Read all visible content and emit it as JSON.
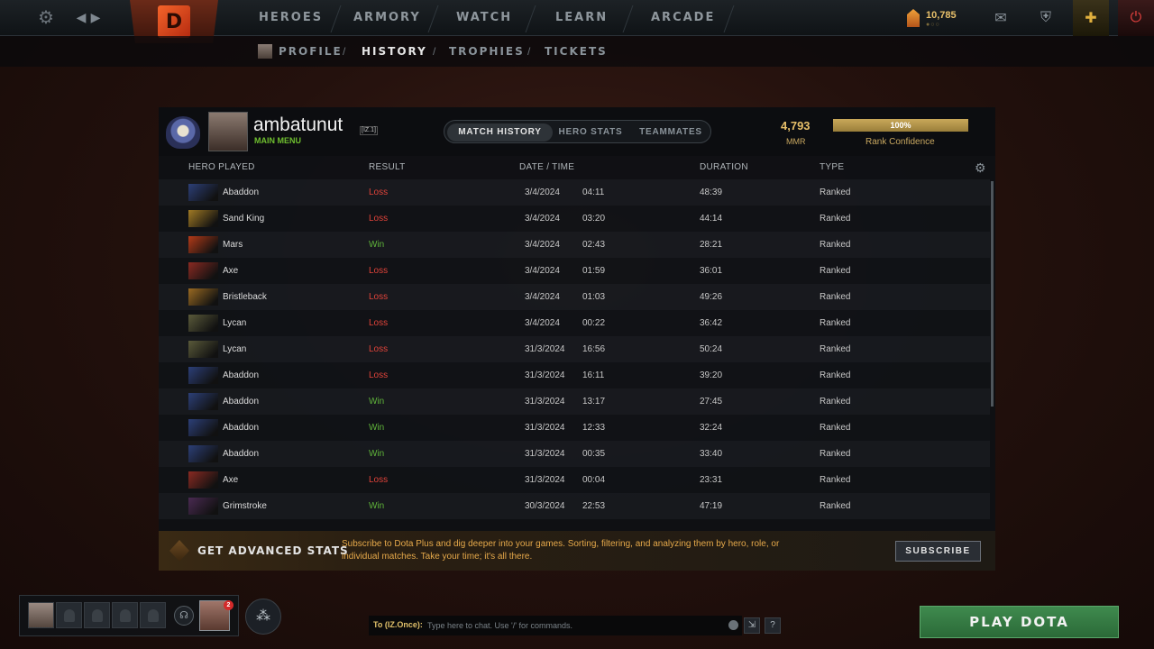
{
  "nav": {
    "items": [
      "HEROES",
      "ARMORY",
      "WATCH",
      "LEARN",
      "ARCADE"
    ],
    "logo_icon": "dota-logo-icon",
    "shards": "10,785"
  },
  "subnav": {
    "items": [
      "PROFILE",
      "HISTORY",
      "TROPHIES",
      "TICKETS"
    ],
    "active": "HISTORY"
  },
  "profile": {
    "name": "ambatunut",
    "tag": "[IZ.1]",
    "status": "MAIN MENU",
    "mmr": "4,793",
    "mmr_label": "MMR",
    "confidence_text": "100%",
    "confidence_fraction": 1.0,
    "confidence_label": "Rank Confidence"
  },
  "tabs": [
    "MATCH HISTORY",
    "HERO STATS",
    "TEAMMATES"
  ],
  "columns": {
    "hero": "HERO PLAYED",
    "result": "RESULT",
    "datetime": "DATE / TIME",
    "duration": "DURATION",
    "type": "TYPE"
  },
  "matches": [
    {
      "hero": "Abaddon",
      "result": "Loss",
      "date": "3/4/2024",
      "time": "04:11",
      "duration": "48:39",
      "type": "Ranked",
      "color": "#2c3f78"
    },
    {
      "hero": "Sand King",
      "result": "Loss",
      "date": "3/4/2024",
      "time": "03:20",
      "duration": "44:14",
      "type": "Ranked",
      "color": "#a07a24"
    },
    {
      "hero": "Mars",
      "result": "Win",
      "date": "3/4/2024",
      "time": "02:43",
      "duration": "28:21",
      "type": "Ranked",
      "color": "#b33a18"
    },
    {
      "hero": "Axe",
      "result": "Loss",
      "date": "3/4/2024",
      "time": "01:59",
      "duration": "36:01",
      "type": "Ranked",
      "color": "#8a2a22"
    },
    {
      "hero": "Bristleback",
      "result": "Loss",
      "date": "3/4/2024",
      "time": "01:03",
      "duration": "49:26",
      "type": "Ranked",
      "color": "#9a6a22"
    },
    {
      "hero": "Lycan",
      "result": "Loss",
      "date": "3/4/2024",
      "time": "00:22",
      "duration": "36:42",
      "type": "Ranked",
      "color": "#5a5a3a"
    },
    {
      "hero": "Lycan",
      "result": "Loss",
      "date": "31/3/2024",
      "time": "16:56",
      "duration": "50:24",
      "type": "Ranked",
      "color": "#5a5a3a"
    },
    {
      "hero": "Abaddon",
      "result": "Loss",
      "date": "31/3/2024",
      "time": "16:11",
      "duration": "39:20",
      "type": "Ranked",
      "color": "#2c3f78"
    },
    {
      "hero": "Abaddon",
      "result": "Win",
      "date": "31/3/2024",
      "time": "13:17",
      "duration": "27:45",
      "type": "Ranked",
      "color": "#2c3f78"
    },
    {
      "hero": "Abaddon",
      "result": "Win",
      "date": "31/3/2024",
      "time": "12:33",
      "duration": "32:24",
      "type": "Ranked",
      "color": "#2c3f78"
    },
    {
      "hero": "Abaddon",
      "result": "Win",
      "date": "31/3/2024",
      "time": "00:35",
      "duration": "33:40",
      "type": "Ranked",
      "color": "#2c3f78"
    },
    {
      "hero": "Axe",
      "result": "Loss",
      "date": "31/3/2024",
      "time": "00:04",
      "duration": "23:31",
      "type": "Ranked",
      "color": "#8a2a22"
    },
    {
      "hero": "Grimstroke",
      "result": "Win",
      "date": "30/3/2024",
      "time": "22:53",
      "duration": "47:19",
      "type": "Ranked",
      "color": "#4a2a52"
    }
  ],
  "promo": {
    "title": "GET ADVANCED STATS",
    "text": "Subscribe to Dota Plus and dig deeper into your games. Sorting, filtering, and analyzing them by hero, role, or individual matches. Take your time; it's all there.",
    "button": "SUBSCRIBE"
  },
  "party": {
    "invite_count": "2"
  },
  "chat": {
    "to": "To (IZ.Once):",
    "placeholder": "Type here to chat. Use '/' for commands."
  },
  "play_button": "PLAY DOTA"
}
